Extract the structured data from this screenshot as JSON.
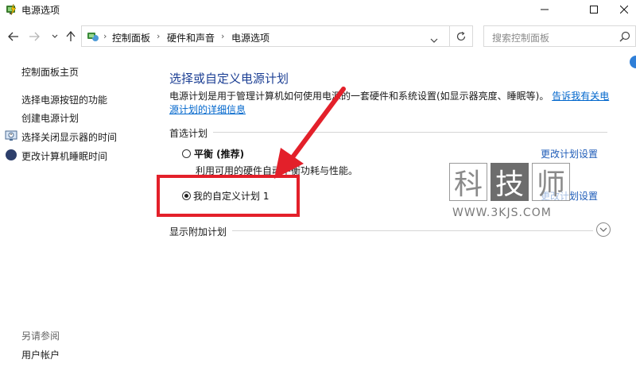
{
  "window": {
    "title": "电源选项",
    "icon": "power-options-icon"
  },
  "address": {
    "breadcrumbs": [
      "控制面板",
      "硬件和声音",
      "电源选项"
    ],
    "search_placeholder": "搜索控制面板"
  },
  "sidebar": {
    "links": [
      "控制面板主页",
      "选择电源按钮的功能",
      "创建电源计划",
      "选择关闭显示器的时间",
      "更改计算机睡眠时间"
    ],
    "see_also_label": "另请参阅",
    "see_also_links": [
      "用户帐户"
    ]
  },
  "main": {
    "heading": "选择或自定义电源计划",
    "description": "电源计划是用于管理计算机如何使用电源的一套硬件和系统设置(如显示器亮度、睡眠等)。",
    "description_link": "告诉我有关电源计划的详细信息",
    "preferred_label": "首选计划",
    "plans": [
      {
        "name": "平衡 (推荐)",
        "description": "利用可用的硬件自动平衡功耗与性能。",
        "settings_link": "更改计划设置",
        "selected": false
      },
      {
        "name": "我的自定义计划 1",
        "description": "",
        "settings_link": "更改计划设置",
        "selected": true
      }
    ],
    "additional_label": "显示附加计划"
  },
  "watermark": {
    "chars": [
      "科",
      "技",
      "师"
    ],
    "url": "WWW.3KJS.COM"
  },
  "colors": {
    "heading": "#1c3f94",
    "link": "#1f5cb8",
    "annotation_red": "#e3202a"
  }
}
